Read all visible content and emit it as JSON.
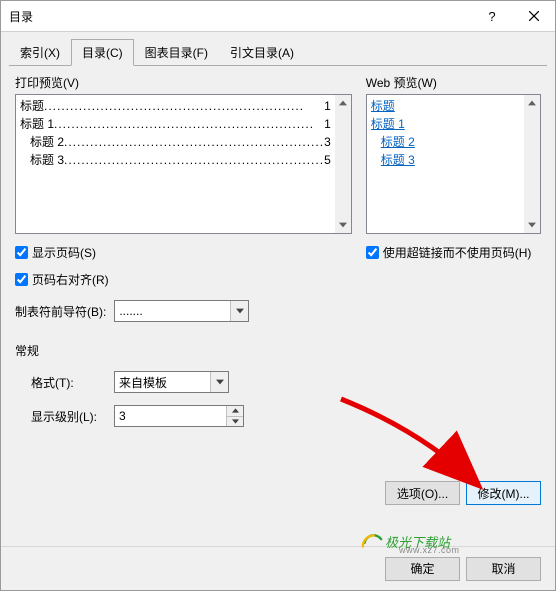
{
  "window_title": "目录",
  "tabs": [
    {
      "label": "索引(X)"
    },
    {
      "label": "目录(C)"
    },
    {
      "label": "图表目录(F)"
    },
    {
      "label": "引文目录(A)"
    }
  ],
  "active_tab_index": 1,
  "print_preview": {
    "label": "打印预览(V)",
    "rows": [
      {
        "indent": 0,
        "text": "标题",
        "page": "1"
      },
      {
        "indent": 0,
        "text": "标题 1",
        "page": "1"
      },
      {
        "indent": 1,
        "text": "标题 2",
        "page": "3"
      },
      {
        "indent": 1,
        "text": "标题 3",
        "page": "5"
      }
    ]
  },
  "web_preview": {
    "label": "Web 预览(W)",
    "rows": [
      {
        "indent": 0,
        "text": "标题"
      },
      {
        "indent": 0,
        "text": "标题 1"
      },
      {
        "indent": 1,
        "text": "标题 2"
      },
      {
        "indent": 1,
        "text": "标题 3"
      }
    ]
  },
  "checkboxes": {
    "show_page": {
      "label": "显示页码(S)",
      "checked": true
    },
    "right_align": {
      "label": "页码右对齐(R)",
      "checked": true
    },
    "hyperlinks": {
      "label": "使用超链接而不使用页码(H)",
      "checked": true
    }
  },
  "leader": {
    "label": "制表符前导符(B):",
    "value": "......."
  },
  "general": {
    "label": "常规",
    "format": {
      "label": "格式(T):",
      "value": "来自模板"
    },
    "levels": {
      "label": "显示级别(L):",
      "value": "3"
    }
  },
  "buttons": {
    "options": "选项(O)...",
    "modify": "修改(M)...",
    "ok": "确定",
    "cancel": "取消"
  },
  "watermark": {
    "text": "极光下载站",
    "sub": "www.xz7.com"
  }
}
